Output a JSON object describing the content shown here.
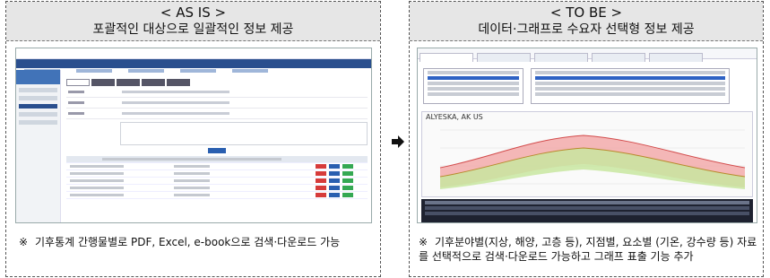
{
  "left": {
    "title": "< AS IS >",
    "subtitle": "포괄적인 대상으로 일괄적인 정보 제공",
    "note_mark": "※",
    "note": "기후통계 간행물별로 PDF, Excel, e-book으로 검색·다운로드 가능"
  },
  "right": {
    "title": "< TO BE >",
    "subtitle": "데이터·그래프로 수요자 선택형 정보 제공",
    "note_mark": "※",
    "note": "기후분야별(지상, 해양, 고층 등), 지점별, 요소별 (기온, 강수량 등) 자료를 선택적으로 검색·다운로드 가능하고 그래프 표출 기능 추가",
    "chart_title": "ALYESKA, AK US"
  },
  "colors": {
    "header_bg": "#e6e6e6",
    "nav_blue": "#2a4f8e",
    "band_red": "#f2a6a6",
    "band_green": "#c8e6a0"
  }
}
